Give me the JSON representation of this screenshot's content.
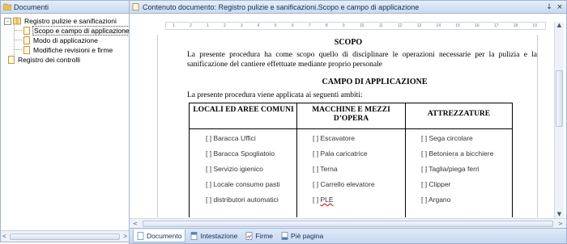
{
  "left_panel": {
    "title": "Documenti",
    "tree": {
      "root1": {
        "label": "Registro pulizie e sanificazioni",
        "expander": "-"
      },
      "children": [
        {
          "label": "Scopo e campo di applicazione"
        },
        {
          "label": "Modo di applicazione"
        },
        {
          "label": "Modifiche revisioni e firme"
        }
      ],
      "root2": {
        "label": "Registro dei controlli"
      }
    },
    "scroll_left": "<",
    "scroll_right": ">"
  },
  "right_panel": {
    "title": "Contenuto documento: Registro pulizie e sanificazioni.Scopo e campo di applicazione",
    "pin": "↓",
    "close": "×",
    "ruler_numbers": [
      "1",
      "2",
      "1",
      "2",
      "3",
      "4",
      "5",
      "6",
      "7",
      "8",
      "9",
      "10",
      "11",
      "12",
      "13",
      "14",
      "15",
      "16",
      "17",
      "18",
      "19"
    ],
    "document": {
      "scopo_title": "SCOPO",
      "scopo_text": "La presente procedura ha come scopo quello di disciplinare le operazioni necessarie per la pulizia e la sanificazione del cantiere effettuate mediante proprio personale",
      "campo_title": "CAMPO DI APPLICAZIONE",
      "intro": "La presente procedura viene applicata ai seguenti ambiti:",
      "table": {
        "headers": [
          "LOCALI ED AREE COMUNI",
          "MACCHINE E MEZZI D’OPERA",
          "ATTREZZATURE"
        ],
        "col1": [
          "[ ] Baracca Uffici",
          "[ ] Baracca Spogliatoio",
          "[ ] Servizio igienico",
          "[ ] Locale consumo pasti",
          "[ ] distributori automatici"
        ],
        "col2_prefix": "[ ] ",
        "col2": [
          "Escavatore",
          "Pala caricatrice",
          "Terna",
          "Carrello elevatore",
          "PLE"
        ],
        "col3": [
          "[ ] Sega circolare",
          "[ ] Betoniera a bicchiere",
          "[ ] Taglia/piega ferri",
          "[ ] Clipper",
          "[ ] Argano"
        ]
      }
    },
    "tabs": [
      "Documento",
      "Intestazione",
      "Firme",
      "Piè pagina"
    ],
    "scroll_left": "<",
    "scroll_right": ">",
    "scroll_up": "▲",
    "scroll_down": "▼"
  }
}
